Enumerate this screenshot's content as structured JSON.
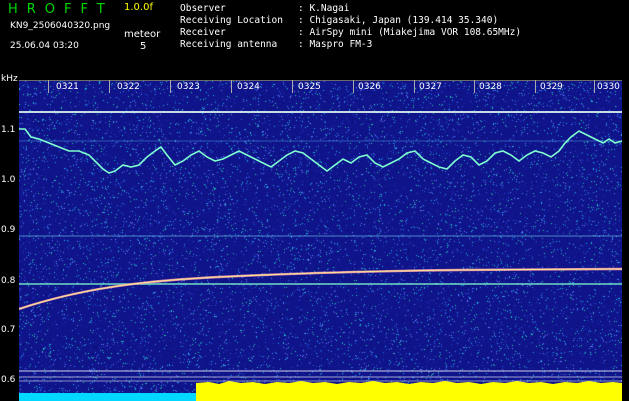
{
  "header": {
    "app_title": "HROFFT",
    "version": "1.0.0f",
    "filename": "KN9_2506040320.png",
    "meteor_label": "meteor",
    "timestamp": "25.06.04 03:20",
    "meteor_count": "5",
    "info": [
      {
        "key": "Observer",
        "value": ": K.Nagai"
      },
      {
        "key": "Receiving Location",
        "value": ": Chigasaki, Japan (139.414 35.340)"
      },
      {
        "key": "Receiver",
        "value": ": AirSpy mini (Miakejima VOR 108.65MHz)"
      },
      {
        "key": "Receiving antenna",
        "value": ": Maspro FM-3"
      }
    ]
  },
  "spectrogram": {
    "y_unit": "kHz",
    "y_ticks": [
      "1.1",
      "1.0",
      "0.9",
      "0.8",
      "0.7",
      "0.6"
    ],
    "x_ticks": [
      "0321",
      "0322",
      "0323",
      "0324",
      "0325",
      "0326",
      "0327",
      "0328",
      "0329",
      "0330"
    ],
    "colors": {
      "background": "#10148a",
      "signal_cyan": "#7fffd0",
      "signal_yellow": "#ffff66",
      "bottom_bar_cyan": "#00d8ff",
      "bottom_bar_yellow": "#ffff00"
    }
  }
}
